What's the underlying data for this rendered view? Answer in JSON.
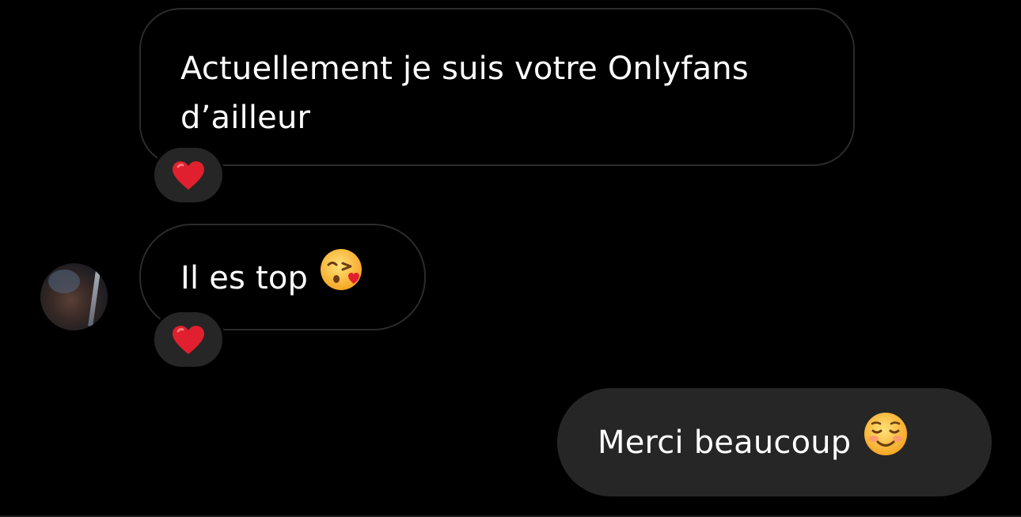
{
  "messages": [
    {
      "direction": "incoming",
      "line1": "Actuellement je suis votre Onlyfans",
      "line2": "d’ailleur",
      "reaction": "heart-emoji"
    },
    {
      "direction": "incoming",
      "text": "Il es top",
      "emoji": "face-blowing-kiss-emoji",
      "reaction": "heart-emoji"
    },
    {
      "direction": "outgoing",
      "text": "Merci beaucoup",
      "emoji": "smiling-face-emoji"
    }
  ],
  "colors": {
    "background": "#000000",
    "incoming_border": "#2b2b2b",
    "outgoing_bubble": "#262626",
    "reaction_pill": "#262626",
    "heart": "#e0202e",
    "text": "#ffffff"
  }
}
